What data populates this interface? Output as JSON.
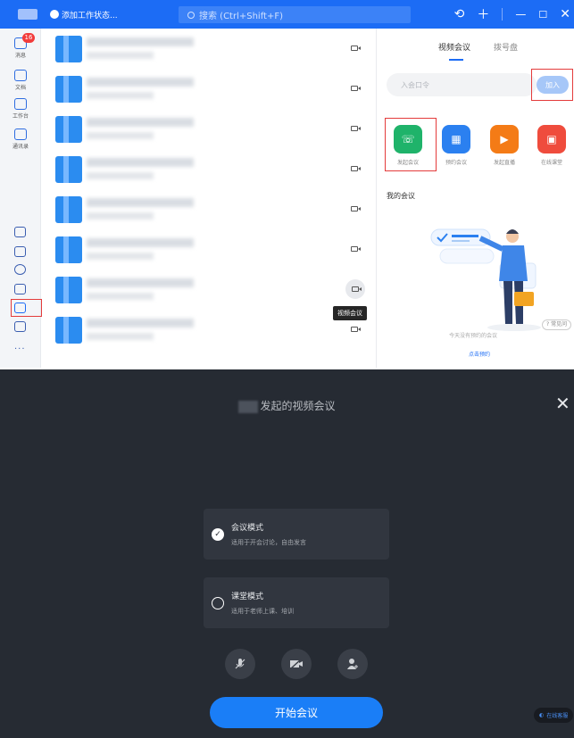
{
  "titlebar": {
    "status_label": "添加工作状态...",
    "search_placeholder": "搜索 (Ctrl+Shift+F)",
    "history_icon": "history-icon",
    "add_icon": "plus-icon",
    "min_icon": "minimize-icon",
    "max_icon": "maximize-icon",
    "close_icon": "close-icon",
    "accent_color": "#1c6cf5"
  },
  "sidebar": {
    "items": [
      {
        "label": "消息",
        "badge": "16",
        "icon": "message-icon"
      },
      {
        "label": "文档",
        "icon": "document-icon"
      },
      {
        "label": "工作台",
        "icon": "workbench-icon"
      },
      {
        "label": "通讯录",
        "icon": "contacts-icon"
      }
    ],
    "bottom_icons": [
      "calendar-icon",
      "todo-icon",
      "favorite-icon",
      "mail-icon",
      "meeting-icon",
      "disk-icon",
      "more-icon"
    ],
    "meeting_annotation": "会议",
    "more_label": "···"
  },
  "list": {
    "tooltip": "视频会议",
    "rows": 8
  },
  "right_panel": {
    "tabs": [
      {
        "label": "视频会议"
      },
      {
        "label": "拨号盘"
      }
    ],
    "code_placeholder": "入会口令",
    "join_label": "加入",
    "actions": [
      {
        "label": "发起会议",
        "color": "#1fb36a",
        "icon": "phone-icon"
      },
      {
        "label": "预约会议",
        "color": "#2b80f0",
        "icon": "calendar-icon"
      },
      {
        "label": "发起直播",
        "color": "#f47b16",
        "icon": "live-icon"
      },
      {
        "label": "在线课堂",
        "color": "#ef4c3d",
        "icon": "classroom-icon"
      }
    ],
    "my_meetings": "我的会议",
    "empty_text": "今天没有预约的会议",
    "book_link": "点击预约",
    "faq": "常见问"
  },
  "dialog": {
    "title_suffix": "发起的视频会议",
    "close_icon": "close-icon",
    "modes": [
      {
        "title": "会议模式",
        "desc": "适用于开会讨论，自由发言",
        "selected": true,
        "check": "✓"
      },
      {
        "title": "课堂模式",
        "desc": "适用于老师上课、培训",
        "selected": false,
        "check": ""
      }
    ],
    "controls": [
      "mic-off-icon",
      "camera-off-icon",
      "add-member-icon"
    ],
    "start_label": "开始会议",
    "service_label": "在线客服"
  }
}
